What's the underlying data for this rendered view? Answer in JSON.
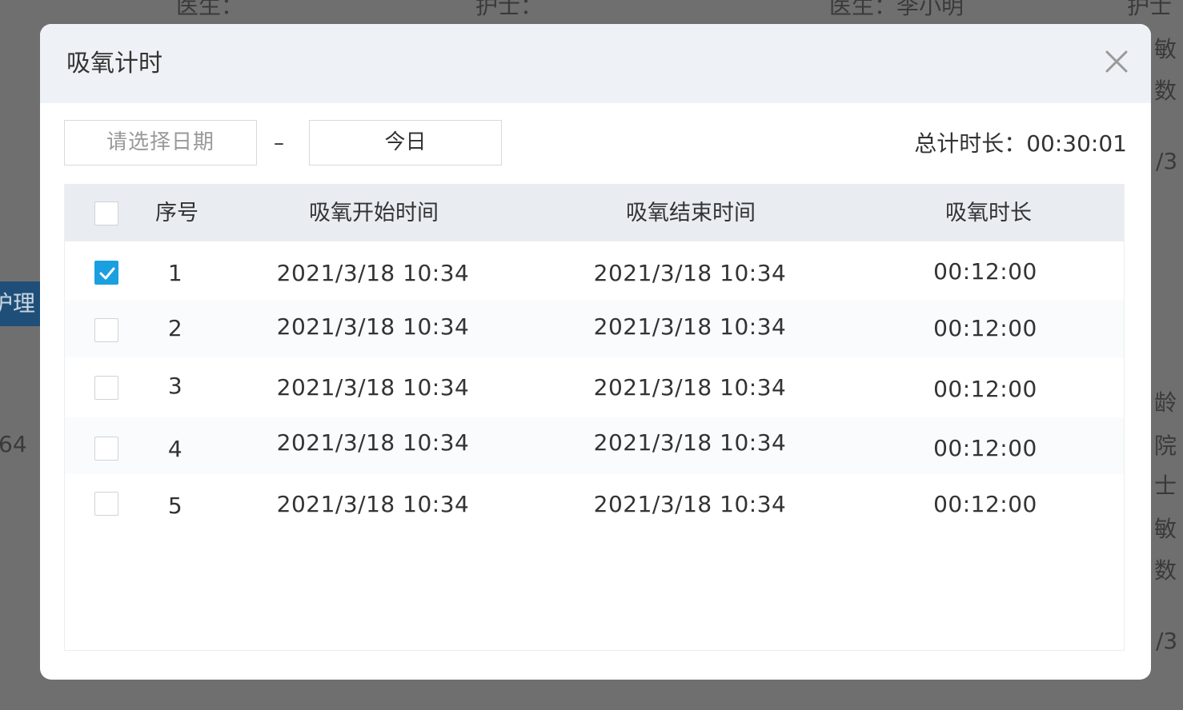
{
  "background": {
    "labels": [
      {
        "id": "bg-doctor-1",
        "text": "医生："
      },
      {
        "id": "bg-nurse-1",
        "text": "护士："
      },
      {
        "id": "bg-doctor-2",
        "text": "医生：李小明"
      },
      {
        "id": "bg-nurse-2",
        "text": "护士"
      },
      {
        "id": "bg-right-1",
        "text": "敏"
      },
      {
        "id": "bg-right-2",
        "text": "数"
      },
      {
        "id": "bg-right-3",
        "text": "/3"
      },
      {
        "id": "bg-left-64",
        "text": "64"
      },
      {
        "id": "bg-right-4",
        "text": "龄"
      },
      {
        "id": "bg-right-5",
        "text": "院"
      },
      {
        "id": "bg-right-6",
        "text": "士"
      },
      {
        "id": "bg-right-7",
        "text": "敏"
      },
      {
        "id": "bg-right-8",
        "text": "数"
      },
      {
        "id": "bg-right-9",
        "text": "/3"
      }
    ],
    "blue_tab_text": "护理"
  },
  "modal": {
    "title": "吸氧计时",
    "close_icon": "close-icon"
  },
  "filter": {
    "start_placeholder": "请选择日期",
    "separator": "–",
    "end_value": "今日",
    "total_label": "总计时长：",
    "total_value": "00:30:01"
  },
  "table": {
    "headers": {
      "index": "序号",
      "start": "吸氧开始时间",
      "end": "吸氧结束时间",
      "duration": "吸氧时长"
    },
    "header_checkbox_checked": false,
    "rows": [
      {
        "index": "1",
        "start": "2021/3/18 10:34",
        "end": "2021/3/18 10:34",
        "duration": "00:12:00",
        "checked": true
      },
      {
        "index": "2",
        "start": "2021/3/18 10:34",
        "end": "2021/3/18 10:34",
        "duration": "00:12:00",
        "checked": false
      },
      {
        "index": "3",
        "start": "2021/3/18 10:34",
        "end": "2021/3/18 10:34",
        "duration": "00:12:00",
        "checked": false
      },
      {
        "index": "4",
        "start": "2021/3/18 10:34",
        "end": "2021/3/18 10:34",
        "duration": "00:12:00",
        "checked": false
      },
      {
        "index": "5",
        "start": "2021/3/18 10:34",
        "end": "2021/3/18 10:34",
        "duration": "00:12:00",
        "checked": false
      }
    ]
  },
  "colors": {
    "accent": "#1aa0e0",
    "header_bg": "#eef1f5",
    "table_header_bg": "#e9edf2",
    "overlay": "#6f6f6f"
  }
}
